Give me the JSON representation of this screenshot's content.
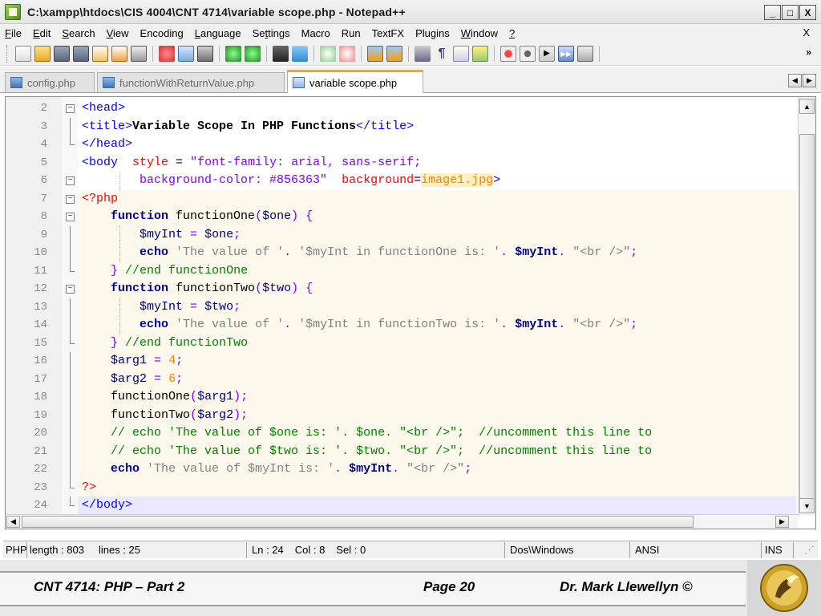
{
  "window": {
    "title": "C:\\xampp\\htdocs\\CIS 4004\\CNT 4714\\variable scope.php - Notepad++",
    "buttons": [
      "_",
      "□",
      "X"
    ]
  },
  "menu": {
    "items": [
      "File",
      "Edit",
      "Search",
      "View",
      "Encoding",
      "Language",
      "Settings",
      "Macro",
      "Run",
      "TextFX",
      "Plugins",
      "Window",
      "?"
    ],
    "close": "X"
  },
  "toolbar": {
    "more": "»",
    "icons": [
      "new-file-icon",
      "open-file-icon",
      "save-icon",
      "save-all-icon",
      "close-icon",
      "close-all-icon",
      "print-icon",
      "cut-icon",
      "copy-icon",
      "paste-icon",
      "undo-icon",
      "redo-icon",
      "find-icon",
      "replace-icon",
      "zoom-in-icon",
      "zoom-out-icon",
      "sync-v-icon",
      "sync-h-icon",
      "wrap-icon",
      "show-all-chars-icon",
      "indent-guide-icon",
      "user-lang-icon",
      "record-macro-icon",
      "stop-macro-icon",
      "play-macro-icon",
      "run-macro-multiple-icon",
      "save-macro-icon"
    ]
  },
  "tabs": [
    {
      "label": "config.php",
      "active": false
    },
    {
      "label": "functionWithReturnValue.php",
      "active": false
    },
    {
      "label": "variable scope.php",
      "active": true
    }
  ],
  "editor": {
    "line_numbers": [
      "2",
      "3",
      "4",
      "5",
      "6",
      "7",
      "8",
      "9",
      "10",
      "11",
      "12",
      "13",
      "14",
      "15",
      "16",
      "17",
      "18",
      "19",
      "20",
      "21",
      "22",
      "23",
      "24"
    ]
  },
  "statusbar": {
    "type": "PHP",
    "length": "length : 803",
    "lines": "lines : 25",
    "ln": "Ln : 24",
    "col": "Col : 8",
    "sel": "Sel : 0",
    "eol": "Dos\\Windows",
    "encoding": "ANSI",
    "mode": "INS"
  },
  "footer": {
    "course": "CNT 4714:  PHP – Part 2",
    "page": "Page 20",
    "author": "Dr. Mark Llewellyn ©"
  }
}
